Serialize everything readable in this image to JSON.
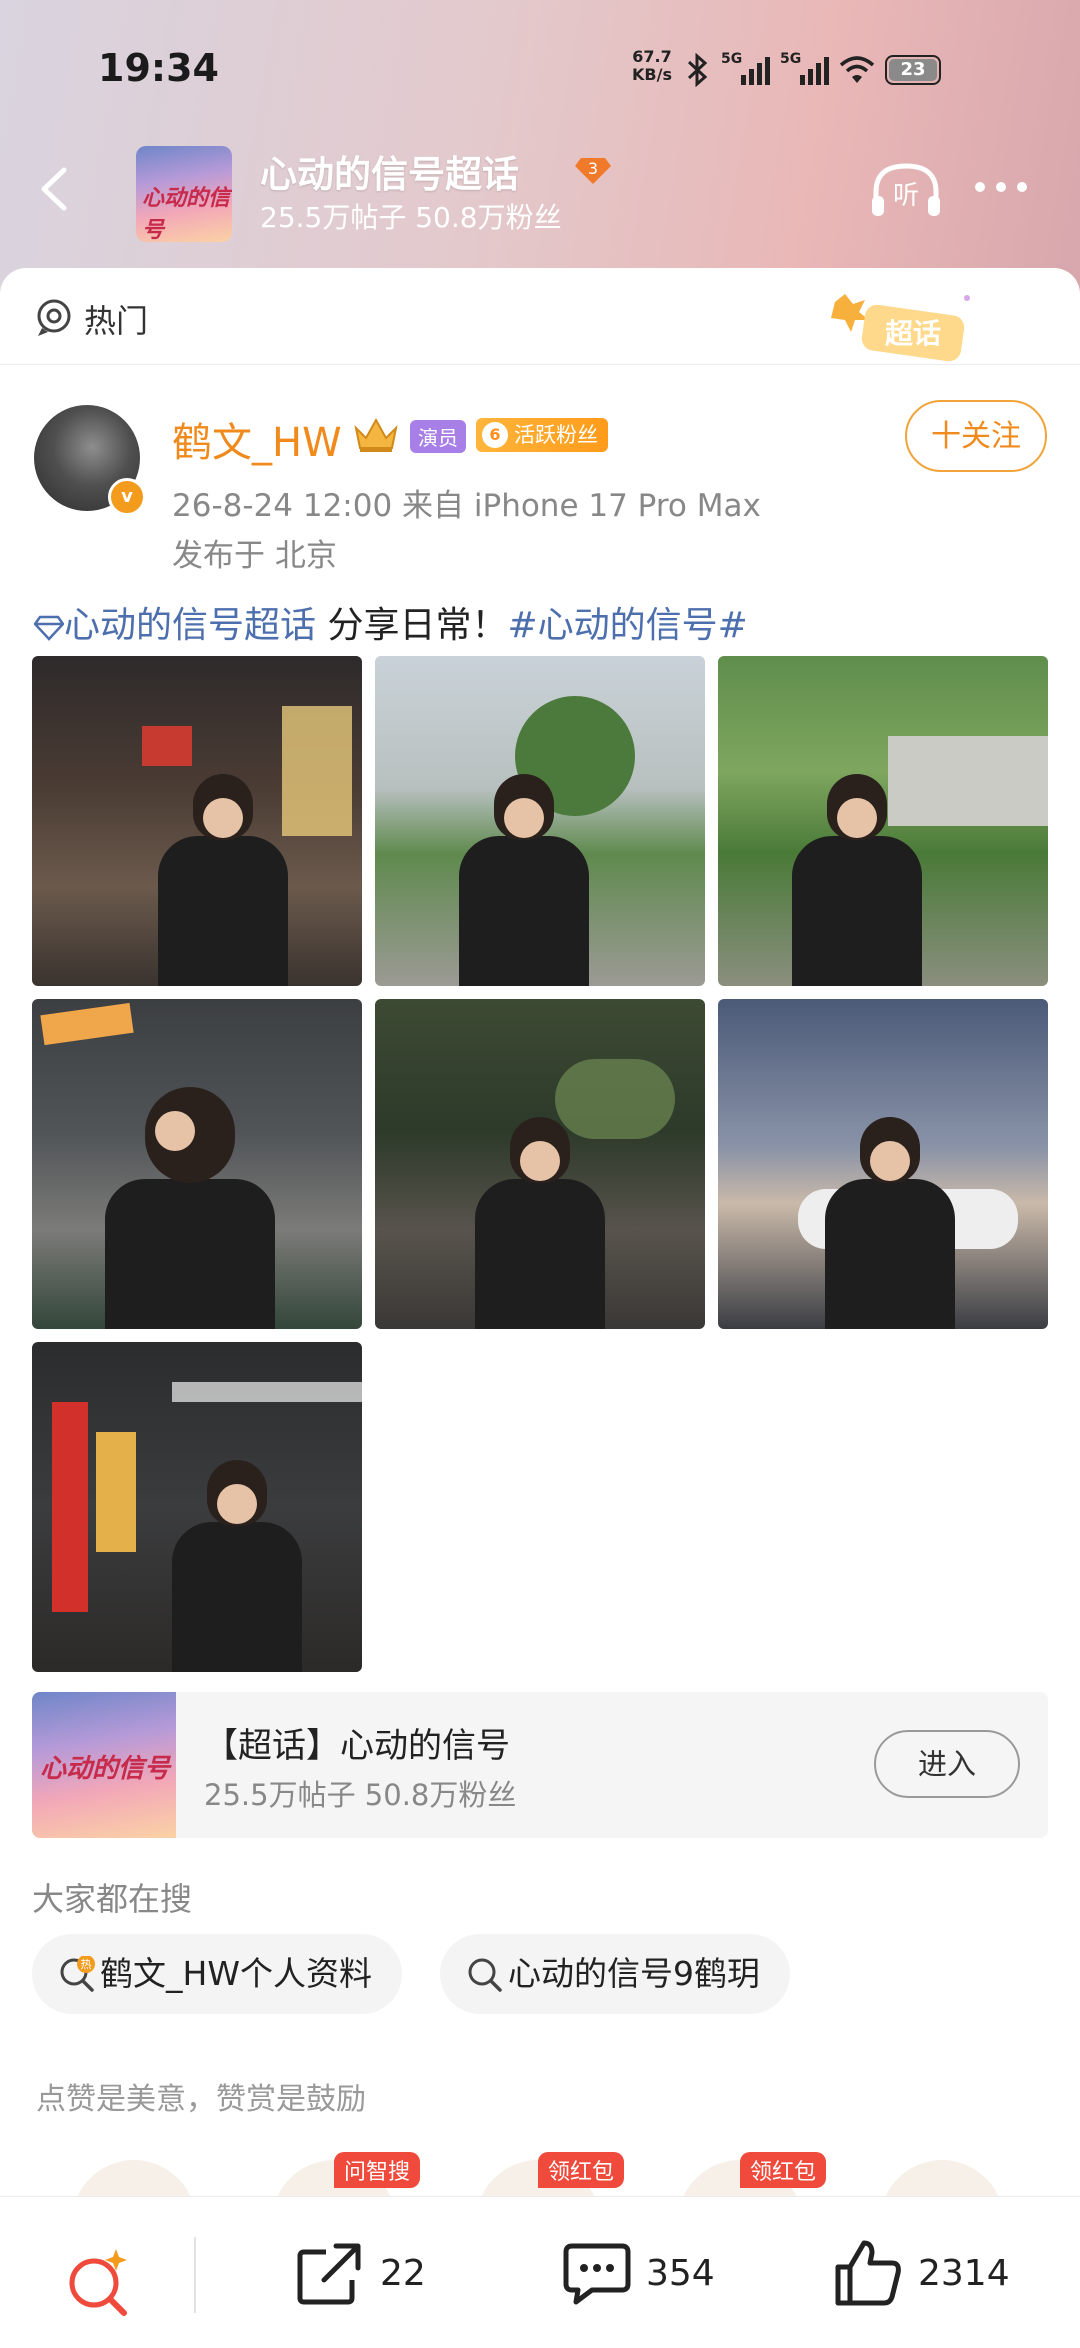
{
  "status_bar": {
    "time": "19:34",
    "net_speed_value": "67.7",
    "net_speed_unit": "KB/s",
    "signal1": "5G",
    "signal2": "5G",
    "wifi_label": "6",
    "battery": "23"
  },
  "header": {
    "title": "心动的信号超话",
    "level": "3",
    "stats": "25.5万帖子 50.8万粉丝",
    "listen_label": "听",
    "cover_text": "心动的信号"
  },
  "hot": {
    "label": "热门",
    "badge": "超话"
  },
  "author": {
    "name": "鹤文_HW",
    "tag_actor": "演员",
    "tag_fan_level": "6",
    "tag_fan": "活跃粉丝",
    "verified_mark": "v",
    "follow_label": "十关注",
    "meta": "26-8-24 12:00   来自 iPhone 17 Pro Max",
    "location": "发布于 北京"
  },
  "post": {
    "topic_link": "心动的信号超话",
    "text": "   分享日常！",
    "hashtag": "#心动的信号#"
  },
  "photos": [
    {
      "scene": "night-street"
    },
    {
      "scene": "plaza"
    },
    {
      "scene": "garden"
    },
    {
      "scene": "cafe-selfie"
    },
    {
      "scene": "avenue-dusk"
    },
    {
      "scene": "roadside-car"
    },
    {
      "scene": "shop-sign"
    }
  ],
  "supertopic_card": {
    "title": "【超话】心动的信号",
    "stats": "25.5万帖子 50.8万粉丝",
    "enter_label": "进入",
    "cover_text": "心动的信号"
  },
  "search": {
    "heading": "大家都在搜",
    "items": [
      "鹤文_HW个人资料",
      "心动的信号9鹤玥"
    ],
    "hot_mark": "热"
  },
  "reward": {
    "note": "点赞是美意，赞赏是鼓励",
    "tags": [
      "问智搜",
      "领红包",
      "领红包"
    ]
  },
  "bottom": {
    "share_count": "22",
    "comment_count": "354",
    "like_count": "2314"
  },
  "colors": {
    "accent": "#f08a1d",
    "link": "#4d6fae",
    "red": "#ef4a3c"
  }
}
